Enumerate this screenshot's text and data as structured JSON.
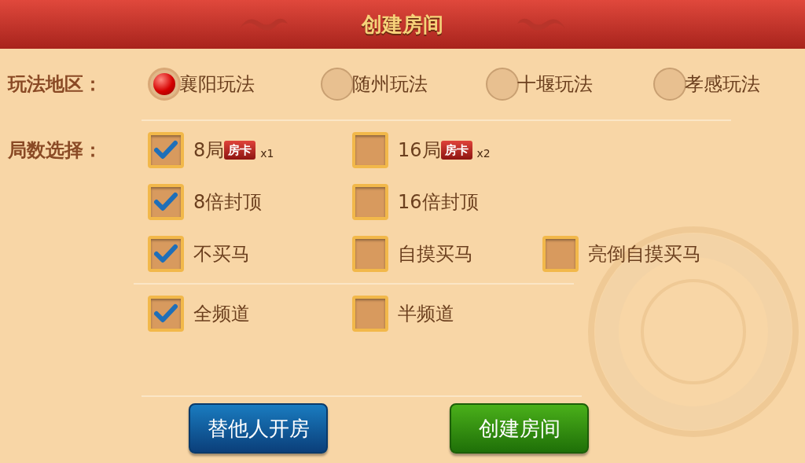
{
  "header": {
    "title": "创建房间"
  },
  "region": {
    "label": "玩法地区：",
    "options": [
      {
        "label": "襄阳玩法",
        "selected": true
      },
      {
        "label": "随州玩法",
        "selected": false
      },
      {
        "label": "十堰玩法",
        "selected": false
      },
      {
        "label": "孝感玩法",
        "selected": false
      }
    ]
  },
  "rounds": {
    "label": "局数选择：",
    "sections": [
      {
        "rows": [
          [
            {
              "label": "8局",
              "badge": "房卡",
              "multiplier": "x1",
              "checked": true
            },
            {
              "label": "16局",
              "badge": "房卡",
              "multiplier": "x2",
              "checked": false
            }
          ],
          [
            {
              "label": "8倍封顶",
              "checked": true
            },
            {
              "label": "16倍封顶",
              "checked": false
            }
          ],
          [
            {
              "label": "不买马",
              "checked": true
            },
            {
              "label": "自摸买马",
              "checked": false
            },
            {
              "label": "亮倒自摸买马",
              "checked": false
            }
          ]
        ]
      },
      {
        "rows": [
          [
            {
              "label": "全频道",
              "checked": true
            },
            {
              "label": "半频道",
              "checked": false
            }
          ]
        ]
      }
    ]
  },
  "buttons": [
    {
      "label": "替他人开房",
      "kind": "secondary"
    },
    {
      "label": "创建房间",
      "kind": "primary"
    }
  ]
}
